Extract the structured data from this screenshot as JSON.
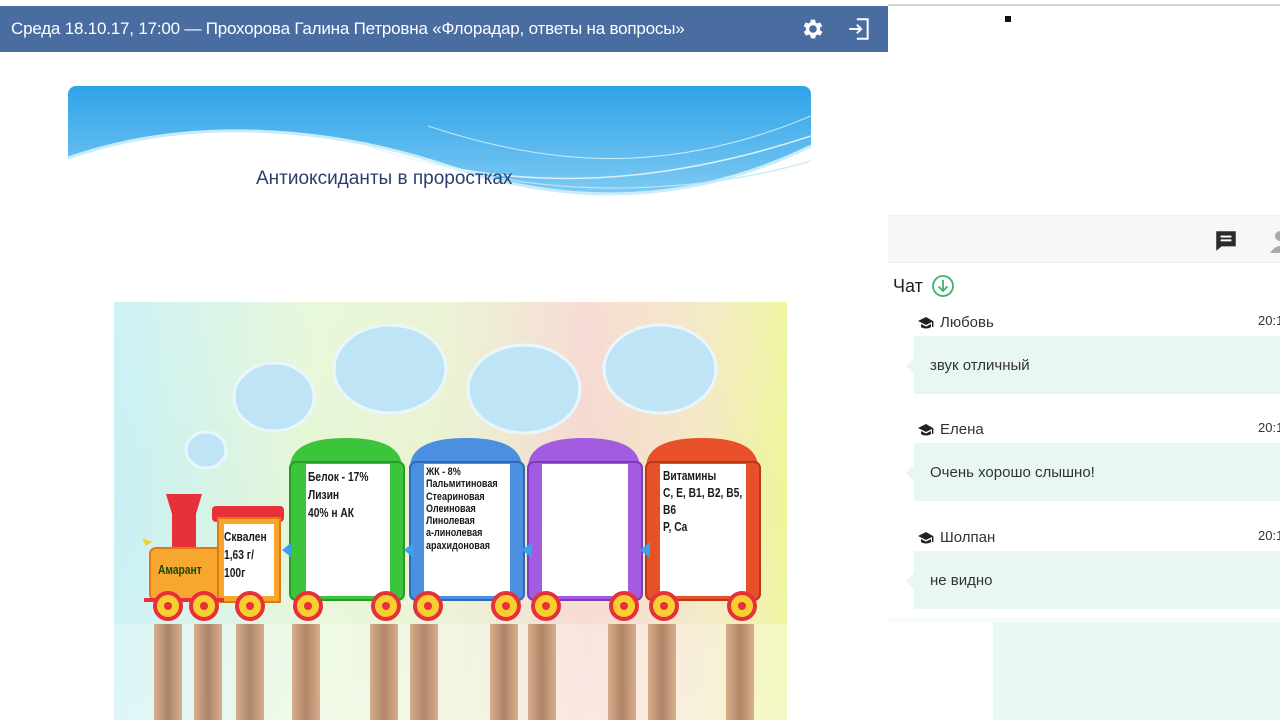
{
  "window": {
    "title": "Среда 18.10.17, 17:00 — Прохорова Галина Петровна «Флорадар, ответы на вопросы»",
    "icons": [
      "gear-icon",
      "exit-icon"
    ]
  },
  "slide": {
    "title": "Антиоксиданты в проростках",
    "picture": {
      "locomotive_label": "Амарант",
      "tender_text": "Сквален\n1,63 г/\n100г",
      "wagons": [
        {
          "text": "Белок - 17%\nЛизин\n40% н АК",
          "color": "#3cc43c"
        },
        {
          "text": "ЖК - 8%\nПальмитиновая\nСтеариновая\nОлеиновая\nЛинолевая\nа-линолевая\nарахидоновая",
          "color": "#4a8fe0"
        },
        {
          "text": "",
          "color": "#a35be0"
        },
        {
          "text": "Витамины\nC, E, B1, B2, B5,\nB6\nP, Ca",
          "color": "#e8502a"
        }
      ]
    }
  },
  "toolbar": {
    "icons": [
      "chat-bubble-icon",
      "user-icon"
    ]
  },
  "chat": {
    "title": "Чат",
    "messages": [
      {
        "author": "Любовь",
        "time": "20:1",
        "text": "звук отличный"
      },
      {
        "author": "Елена",
        "time": "20:1",
        "text": "Очень хорошо слышно!"
      },
      {
        "author": "Шолпан",
        "time": "20:1",
        "text": "не видно"
      }
    ]
  },
  "colors": {
    "title_bar": "#4a6da1",
    "bubble": "#e9f7f2",
    "chat_accent": "#3cb371"
  }
}
